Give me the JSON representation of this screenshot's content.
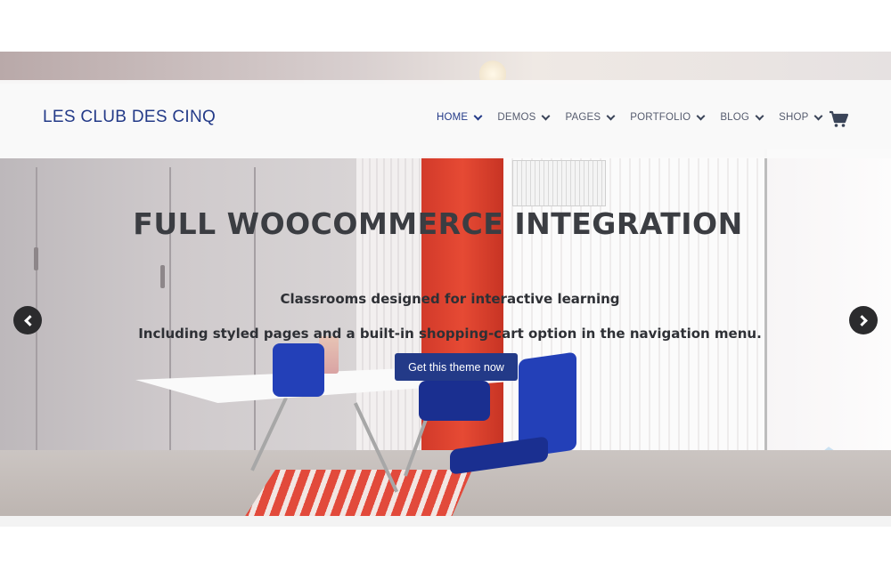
{
  "header": {
    "logo": "LES CLUB DES CINQ",
    "nav": [
      {
        "label": "HOME",
        "active": true
      },
      {
        "label": "DEMOS"
      },
      {
        "label": "PAGES"
      },
      {
        "label": "PORTFOLIO"
      },
      {
        "label": "BLOG"
      },
      {
        "label": "SHOP"
      }
    ],
    "cart_icon": "shopping-cart-icon"
  },
  "hero": {
    "title": "FULL WOOCOMMERCE INTEGRATION",
    "subtitle_1": "Classrooms designed for interactive learning",
    "subtitle_2": "Including styled pages and a built-in shopping-cart option in the navigation menu.",
    "cta_label": "Get this theme now",
    "prev_icon": "chevron-left-icon",
    "next_icon": "chevron-right-icon"
  },
  "colors": {
    "brand": "#233a88",
    "nav_text": "#555b6e",
    "title_text": "#3b3d42",
    "arrow_bg": "#2b2b2d"
  }
}
